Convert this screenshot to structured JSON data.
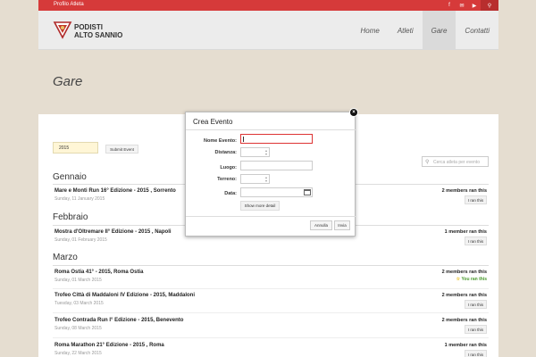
{
  "topbar": {
    "profile_label": "Profilo Atleta",
    "icons": [
      "facebook-icon",
      "mail-icon",
      "youtube-icon",
      "search-icon"
    ]
  },
  "header": {
    "logo_line1": "PODISTI",
    "logo_line2": "ALTO SANNIO",
    "nav": [
      "Home",
      "Atleti",
      "Gare",
      "Contatti"
    ],
    "active_nav": "Gare"
  },
  "page_title": "Gare",
  "toolbar": {
    "year": "2015",
    "submit_label": "Submit Event",
    "search_placeholder": "Cerca atleta per evento"
  },
  "months": [
    {
      "name": "Gennaio",
      "events": [
        {
          "title": "Mare e Monti Run 16° Edizione - 2015 , Sorrento",
          "date": "Sunday, 11 January 2015",
          "count": "2 members ran this",
          "action": "I ran this",
          "ran": false
        }
      ]
    },
    {
      "name": "Febbraio",
      "events": [
        {
          "title": "Mostra d'Oltremare II° Edizione - 2015 , Napoli",
          "date": "Sunday, 01 February 2015",
          "count": "1 member ran this",
          "action": "I ran this",
          "ran": false
        }
      ]
    },
    {
      "name": "Marzo",
      "events": [
        {
          "title": "Roma Ostia 41° - 2015, Roma Ostia",
          "date": "Sunday, 01 March 2015",
          "count": "2 members ran this",
          "action": "You ran this",
          "ran": true
        },
        {
          "title": "Trofeo Città di Maddaloni IV Edizione - 2015, Maddaloni",
          "date": "Tuesday, 03 March 2015",
          "count": "2 members ran this",
          "action": "I ran this",
          "ran": false
        },
        {
          "title": "Trofeo Contrada Run I° Edizione - 2015, Benevento",
          "date": "Sunday, 08 March 2015",
          "count": "2 members ran this",
          "action": "I ran this",
          "ran": false
        },
        {
          "title": "Roma Marathon 21° Edizione - 2015 , Roma",
          "date": "Sunday, 22 March 2015",
          "count": "1 member ran this",
          "action": "I ran this",
          "ran": false
        }
      ]
    }
  ],
  "modal": {
    "title": "Crea Evento",
    "fields": {
      "nome": "Nome Evento:",
      "distanza": "Distanza:",
      "luogo": "Luogo:",
      "terreno": "Terreno:",
      "data": "Data:"
    },
    "show_more": "Show more detail",
    "cancel": "Annulla",
    "submit": "Invia",
    "close": "×"
  }
}
